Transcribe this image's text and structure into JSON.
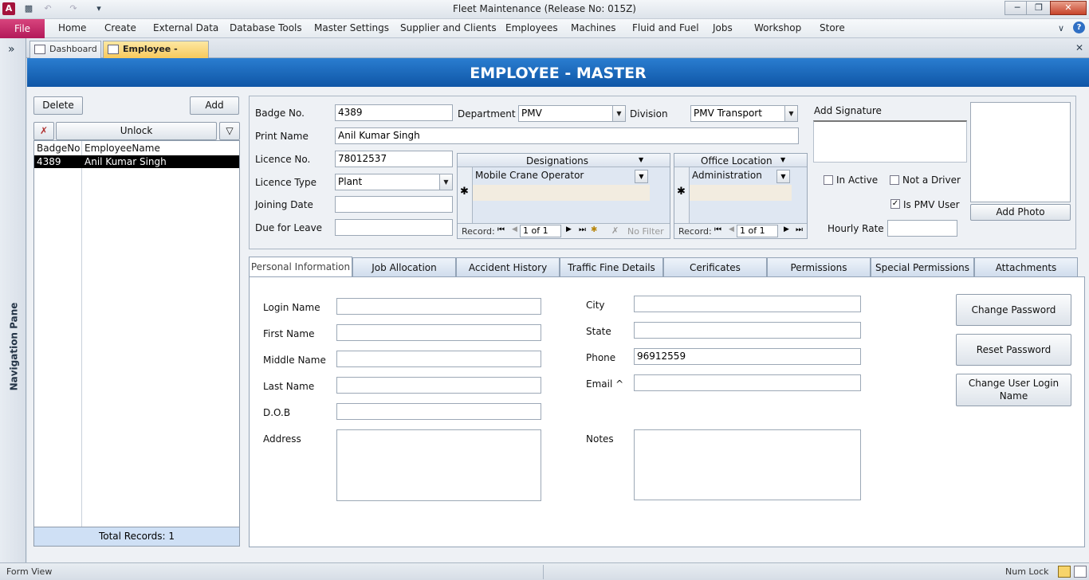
{
  "app": {
    "title": "Fleet Maintenance (Release No: 015Z)",
    "icon": "A"
  },
  "ribbon": {
    "file": "File",
    "menu": [
      "Home",
      "Create",
      "External Data",
      "Database Tools",
      "Master Settings",
      "Supplier and Clients",
      "Employees",
      "Machines",
      "Fluid and Fuel",
      "Jobs",
      "Workshop",
      "Store"
    ]
  },
  "doc_tabs": [
    "Dashboard",
    "Employee - Master"
  ],
  "nav": {
    "label": "Navigation Pane",
    "toggle": "»"
  },
  "header": "EMPLOYEE - MASTER",
  "left": {
    "delete": "Delete",
    "add": "Add",
    "unlock": "Unlock",
    "columns": [
      "BadgeNo",
      "EmployeeName"
    ],
    "rows": [
      {
        "badge": "4389",
        "name": "Anil Kumar Singh"
      }
    ],
    "total": "Total Records: 1"
  },
  "form": {
    "badge_label": "Badge No.",
    "badge": "4389",
    "department_label": "Department",
    "department": "PMV",
    "division_label": "Division",
    "division": "PMV Transport",
    "print_name_label": "Print Name",
    "print_name": "Anil Kumar Singh",
    "licence_no_label": "Licence No.",
    "licence_no": "78012537",
    "licence_type_label": "Licence Type",
    "licence_type": "Plant",
    "joining_label": "Joining Date",
    "joining": "",
    "leave_label": "Due for Leave",
    "leave": "",
    "signature_label": "Add Signature",
    "in_active": "In Active",
    "not_driver": "Not a Driver",
    "is_pmv": "Is PMV User",
    "hourly_label": "Hourly Rate",
    "hourly": "",
    "add_photo": "Add Photo"
  },
  "designations": {
    "header": "Designations",
    "value": "Mobile Crane Operator",
    "record_label": "Record:",
    "record": "1 of 1",
    "no_filter": "No Filter"
  },
  "office": {
    "header": "Office Location",
    "value": "Administration",
    "record_label": "Record:",
    "record": "1 of 1"
  },
  "tabs": [
    "Personal Information",
    "Job Allocation",
    "Accident History",
    "Traffic Fine Details",
    "Cerificates",
    "Permissions",
    "Special Permissions",
    "Attachments"
  ],
  "personal": {
    "login_label": "Login Name",
    "login": "",
    "first_label": "First Name",
    "first": "",
    "middle_label": "Middle Name",
    "middle": "",
    "last_label": "Last Name",
    "last": "",
    "dob_label": "D.O.B",
    "dob": "",
    "address_label": "Address",
    "address": "",
    "city_label": "City",
    "city": "",
    "state_label": "State",
    "state": "",
    "phone_label": "Phone",
    "phone": "96912559",
    "email_label": "Email ^",
    "email": "",
    "notes_label": "Notes",
    "notes": "",
    "change_password": "Change Password",
    "reset_password": "Reset Password",
    "change_login": "Change User Login Name"
  },
  "status": {
    "left": "Form View",
    "right": "Num Lock"
  }
}
